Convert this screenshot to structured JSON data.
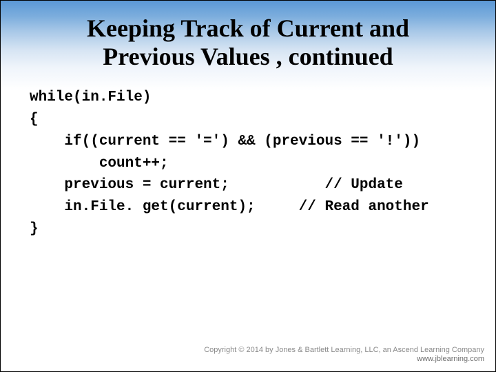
{
  "title_line1": "Keeping Track of Current and",
  "title_line2": "Previous Values , continued",
  "code": "while(in.File)\n{\n    if((current == '=') && (previous == '!'))\n        count++;\n    previous = current;           // Update\n    in.File. get(current);     // Read another\n}",
  "footer": {
    "copyright": "Copyright © 2014 by Jones & Bartlett Learning, LLC, an Ascend Learning Company",
    "url": "www.jblearning.com"
  }
}
